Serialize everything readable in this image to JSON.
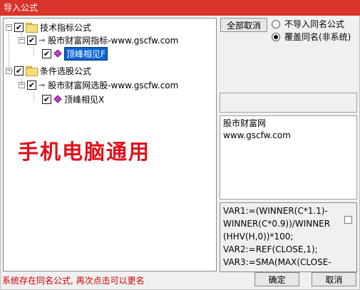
{
  "window": {
    "title": "导入公式"
  },
  "tree": {
    "nodes": [
      {
        "label": "技术指标公式",
        "checked": true
      },
      {
        "label": "股市财富网指标-www.gscfw.com",
        "checked": true
      },
      {
        "label": "顶峰相见F",
        "checked": true
      },
      {
        "label": "条件选股公式",
        "checked": true
      },
      {
        "label": "股市财富网选股-www.gscfw.com",
        "checked": true
      },
      {
        "label": "顶峰相见X",
        "checked": true
      }
    ]
  },
  "watermark": "手机电脑通用",
  "actions": {
    "deselect_all": "全部取消",
    "option_skip": "不导入同名公式",
    "option_overwrite": "覆盖同名(非系统)",
    "selected_option": "option_overwrite"
  },
  "description": "股市财富网\nwww.gscfw.com",
  "formula_preview": "VAR1:=(WINNER(C*1.1)-\nWINNER(C*0.9))/WINNER\n(HHV(H,0))*100;\nVAR2:=REF(CLOSE,1);\nVAR3:=SMA(MAX(CLOSE-",
  "status_message": "系统存在同名公式, 再次点击可以更名",
  "buttons": {
    "ok": "确定",
    "cancel": "取消"
  }
}
